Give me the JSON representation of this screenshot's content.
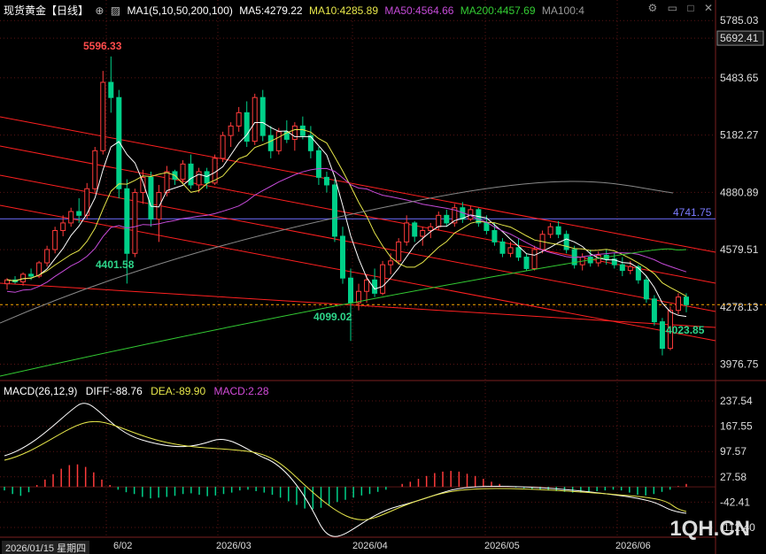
{
  "header": {
    "title": "现货黄金【日线】",
    "settings_icon": "circle-plus-icon",
    "indicator_icon": "chart-icon",
    "ma_label": "MA1(5,10,50,200,100)",
    "ma5": "MA5:4279.22",
    "ma10": "MA10:4285.89",
    "ma50": "MA50:4564.66",
    "ma200": "MA200:4457.69",
    "ma100": "MA100:4"
  },
  "window_controls": {
    "icons": [
      "settings-icon",
      "restore-icon",
      "max-icon",
      "close-icon"
    ],
    "glyphs": [
      "⚙",
      "▭",
      "□",
      "✕"
    ]
  },
  "price_axis": {
    "labels": [
      "5785.03",
      "5692.41",
      "5483.65",
      "5182.27",
      "4880.89",
      "4579.51",
      "4278.13",
      "3976.75"
    ],
    "highlighted": "5692.41"
  },
  "macd_axis": {
    "labels": [
      "237.54",
      "167.55",
      "97.57",
      "27.58",
      "-42.41",
      "-112.40"
    ]
  },
  "annotations": {
    "high": "5596.33",
    "low1": "4401.58",
    "low2": "4099.02",
    "low3": "4023.85",
    "hline": "4741.75"
  },
  "macd": {
    "title": "MACD(26,12,9)",
    "diff": "DIFF:-88.76",
    "dea": "DEA:-89.90",
    "macd": "MACD:2.28"
  },
  "dates": {
    "current": "2026/01/15 星期四",
    "partial": "6/02",
    "mar": "2026/03",
    "apr": "2026/04",
    "may": "2026/05",
    "jun": "2026/06"
  },
  "logo": "1QH.CN",
  "colors": {
    "up": "#ff3b3b",
    "down": "#00d089",
    "ma5": "#ffffff",
    "ma10": "#e6e64a",
    "ma50": "#c54bd8",
    "ma200": "#33cc33",
    "ma100": "#888888",
    "grid": "#7a2020",
    "channel": "#ff2020"
  },
  "chart_data": {
    "type": "candlestick",
    "symbol": "现货黄金",
    "period": "日线",
    "ylim": [
      3900,
      5800
    ],
    "candles": [
      [
        4400,
        4430,
        4370,
        4420
      ],
      [
        4420,
        4440,
        4400,
        4410
      ],
      [
        4410,
        4460,
        4390,
        4450
      ],
      [
        4450,
        4480,
        4420,
        4440
      ],
      [
        4440,
        4520,
        4430,
        4510
      ],
      [
        4510,
        4600,
        4490,
        4580
      ],
      [
        4580,
        4700,
        4560,
        4680
      ],
      [
        4680,
        4760,
        4650,
        4720
      ],
      [
        4720,
        4800,
        4700,
        4780
      ],
      [
        4780,
        4850,
        4720,
        4760
      ],
      [
        4760,
        4930,
        4740,
        4900
      ],
      [
        4900,
        5120,
        4880,
        5100
      ],
      [
        5100,
        5520,
        5080,
        5460
      ],
      [
        5460,
        5596,
        5300,
        5380
      ],
      [
        5380,
        5420,
        4850,
        4900
      ],
      [
        4900,
        4950,
        4401,
        4560
      ],
      [
        4560,
        4900,
        4540,
        4880
      ],
      [
        4880,
        5000,
        4820,
        4960
      ],
      [
        4960,
        4990,
        4700,
        4740
      ],
      [
        4740,
        4920,
        4620,
        4880
      ],
      [
        4880,
        5020,
        4860,
        4990
      ],
      [
        4990,
        5000,
        4920,
        4950
      ],
      [
        4950,
        5050,
        4930,
        5030
      ],
      [
        5030,
        5080,
        4900,
        4920
      ],
      [
        4920,
        5010,
        4880,
        4990
      ],
      [
        4990,
        5010,
        4900,
        4930
      ],
      [
        4930,
        5080,
        4920,
        5060
      ],
      [
        5060,
        5200,
        5040,
        5180
      ],
      [
        5180,
        5250,
        5120,
        5230
      ],
      [
        5230,
        5330,
        5200,
        5300
      ],
      [
        5300,
        5360,
        5120,
        5150
      ],
      [
        5150,
        5400,
        5130,
        5380
      ],
      [
        5380,
        5420,
        5150,
        5180
      ],
      [
        5180,
        5230,
        5060,
        5100
      ],
      [
        5100,
        5220,
        5080,
        5200
      ],
      [
        5200,
        5260,
        5140,
        5160
      ],
      [
        5160,
        5250,
        5100,
        5230
      ],
      [
        5230,
        5280,
        5160,
        5180
      ],
      [
        5180,
        5230,
        5060,
        5100
      ],
      [
        5100,
        5120,
        4920,
        4960
      ],
      [
        4960,
        4990,
        4880,
        4920
      ],
      [
        4920,
        4950,
        4620,
        4650
      ],
      [
        4650,
        4700,
        4400,
        4430
      ],
      [
        4430,
        4480,
        4099,
        4300
      ],
      [
        4300,
        4400,
        4260,
        4360
      ],
      [
        4360,
        4450,
        4300,
        4420
      ],
      [
        4420,
        4480,
        4330,
        4350
      ],
      [
        4350,
        4520,
        4340,
        4500
      ],
      [
        4500,
        4560,
        4450,
        4520
      ],
      [
        4520,
        4640,
        4500,
        4620
      ],
      [
        4620,
        4760,
        4600,
        4720
      ],
      [
        4720,
        4730,
        4620,
        4650
      ],
      [
        4650,
        4700,
        4600,
        4680
      ],
      [
        4680,
        4720,
        4640,
        4700
      ],
      [
        4700,
        4780,
        4680,
        4760
      ],
      [
        4760,
        4790,
        4700,
        4720
      ],
      [
        4720,
        4820,
        4700,
        4800
      ],
      [
        4800,
        4830,
        4720,
        4740
      ],
      [
        4740,
        4810,
        4730,
        4790
      ],
      [
        4790,
        4800,
        4700,
        4720
      ],
      [
        4720,
        4760,
        4660,
        4680
      ],
      [
        4680,
        4720,
        4600,
        4620
      ],
      [
        4620,
        4640,
        4540,
        4560
      ],
      [
        4560,
        4620,
        4540,
        4590
      ],
      [
        4590,
        4640,
        4520,
        4540
      ],
      [
        4540,
        4560,
        4470,
        4480
      ],
      [
        4480,
        4600,
        4470,
        4580
      ],
      [
        4580,
        4680,
        4560,
        4660
      ],
      [
        4660,
        4720,
        4640,
        4700
      ],
      [
        4700,
        4730,
        4640,
        4660
      ],
      [
        4660,
        4680,
        4560,
        4580
      ],
      [
        4580,
        4600,
        4480,
        4500
      ],
      [
        4500,
        4560,
        4470,
        4540
      ],
      [
        4540,
        4580,
        4490,
        4510
      ],
      [
        4510,
        4570,
        4490,
        4550
      ],
      [
        4550,
        4580,
        4500,
        4530
      ],
      [
        4530,
        4560,
        4480,
        4500
      ],
      [
        4500,
        4540,
        4440,
        4470
      ],
      [
        4470,
        4520,
        4450,
        4490
      ],
      [
        4490,
        4500,
        4400,
        4420
      ],
      [
        4420,
        4440,
        4300,
        4320
      ],
      [
        4320,
        4340,
        4180,
        4200
      ],
      [
        4200,
        4220,
        4023,
        4060
      ],
      [
        4060,
        4280,
        4050,
        4260
      ],
      [
        4260,
        4350,
        4240,
        4330
      ],
      [
        4330,
        4350,
        4250,
        4290
      ]
    ],
    "hline": 4741.75,
    "macd_ylim": [
      -112.4,
      237.54
    ]
  }
}
